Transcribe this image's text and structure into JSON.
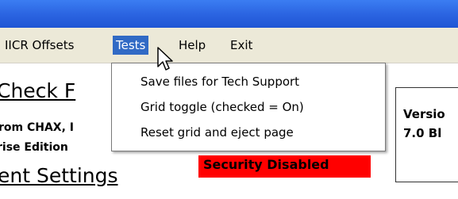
{
  "menu": {
    "items": [
      {
        "label": "IICR Offsets"
      },
      {
        "label": "Tests"
      },
      {
        "label": "Help"
      },
      {
        "label": "Exit"
      }
    ]
  },
  "tests_menu": {
    "items": [
      {
        "label": "Save files for Tech Support"
      },
      {
        "label": "Grid toggle (checked = On)"
      },
      {
        "label": "Reset grid and  eject page"
      }
    ]
  },
  "content": {
    "heading_check": "Check F",
    "from_line": "rom CHAX, I",
    "edition_line": "rise Edition",
    "heading_settings": "ent Settings",
    "security_status": "Security Disabled",
    "version_label": "Versio",
    "version_value": "7.0 Bl"
  },
  "colors": {
    "titlebar": "#2a63e0",
    "menu_highlight": "#316ac5",
    "security_bg": "#ff0000"
  }
}
